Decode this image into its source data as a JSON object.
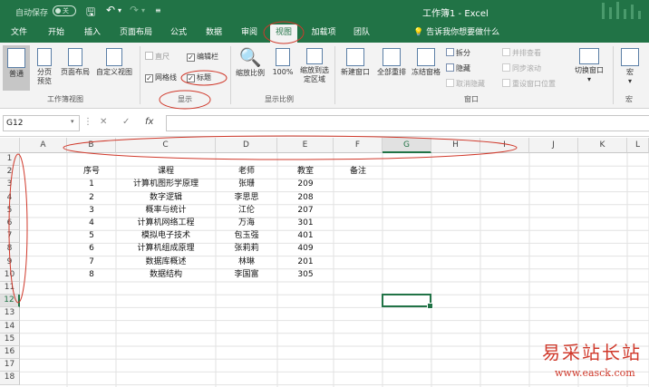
{
  "titlebar": {
    "autosave_label": "自动保存",
    "autosave_state": "关",
    "title": "工作簿1  -  Excel"
  },
  "tabs": [
    "文件",
    "开始",
    "插入",
    "页面布局",
    "公式",
    "数据",
    "审阅",
    "视图",
    "加载项",
    "团队"
  ],
  "active_tab": "视图",
  "tell_me": "告诉我你想要做什么",
  "ribbon": {
    "views": {
      "normal": "普通",
      "page_break": "分页预览",
      "page_layout": "页面布局",
      "custom_views": "自定义视图",
      "label": "工作簿视图"
    },
    "show": {
      "ruler": "直尺",
      "gridlines": "网格线",
      "formula_bar": "编辑栏",
      "headings": "标题",
      "label": "显示"
    },
    "zoom": {
      "zoom": "缩放比例",
      "hundred": "100%",
      "to_selection": "缩放到选定区域",
      "label": "显示比例"
    },
    "window": {
      "new_window": "新建窗口",
      "arrange_all": "全部重排",
      "freeze": "冻结窗格",
      "split": "拆分",
      "hide": "隐藏",
      "unhide": "取消隐藏",
      "side_by_side": "并排查看",
      "sync_scroll": "同步滚动",
      "reset_position": "重设窗口位置",
      "label": "窗口"
    },
    "switch_windows": "切换窗口",
    "macros": {
      "macros": "宏",
      "label": "宏"
    }
  },
  "formula_bar": {
    "name_box": "G12",
    "fx": "fx",
    "formula": ""
  },
  "sheet": {
    "columns": [
      "A",
      "B",
      "C",
      "D",
      "E",
      "F",
      "G",
      "H",
      "I",
      "J",
      "K",
      "L"
    ],
    "rows": [
      "1",
      "2",
      "3",
      "4",
      "5",
      "6",
      "7",
      "8",
      "9",
      "10",
      "11",
      "12",
      "13",
      "14",
      "15",
      "16",
      "17",
      "18"
    ],
    "selected_cell": "G12",
    "headers": [
      "序号",
      "课程",
      "老师",
      "教室",
      "备注"
    ],
    "data": [
      [
        "1",
        "计算机图形学原理",
        "张珊",
        "209"
      ],
      [
        "2",
        "数字逻辑",
        "李思思",
        "208"
      ],
      [
        "3",
        "概率与统计",
        "江伦",
        "207"
      ],
      [
        "4",
        "计算机网络工程",
        "万海",
        "301"
      ],
      [
        "5",
        "模拟电子技术",
        "包玉强",
        "401"
      ],
      [
        "6",
        "计算机组成原理",
        "张莉莉",
        "409"
      ],
      [
        "7",
        "数据库概述",
        "林琳",
        "201"
      ],
      [
        "8",
        "数据结构",
        "李国富",
        "305"
      ]
    ]
  },
  "watermark": {
    "title": "易采站长站",
    "url": "www.easck.com"
  },
  "colors": {
    "excel_green": "#217346",
    "annotation_red": "#d0392b"
  }
}
